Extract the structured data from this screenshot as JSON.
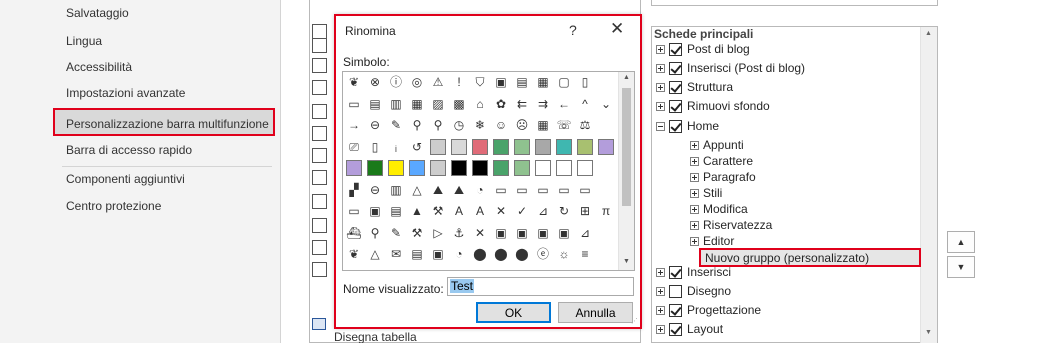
{
  "nav": {
    "items": [
      {
        "label": "Salvataggio",
        "name": "nav-item-salvataggio"
      },
      {
        "label": "Lingua",
        "name": "nav-item-lingua"
      },
      {
        "label": "Accessibilità",
        "name": "nav-item-accessibilita"
      },
      {
        "label": "Impostazioni avanzate",
        "name": "nav-item-impostazioni-avanzate"
      },
      {
        "label": "Personalizzazione barra multifunzione",
        "name": "nav-item-personalizzazione-barra",
        "selected": true
      },
      {
        "label": "Barra di accesso rapido",
        "name": "nav-item-barra-accesso-rapido"
      },
      {
        "label": "Componenti aggiuntivi",
        "name": "nav-item-componenti-aggiuntivi"
      },
      {
        "label": "Centro protezione",
        "name": "nav-item-centro-protezione"
      }
    ]
  },
  "commands": {
    "bottom_item": "Disegna tabella"
  },
  "tree": {
    "header": "Schede principali",
    "rows": [
      {
        "label": "Post di blog",
        "checked": true,
        "level": 0,
        "expander": "plus"
      },
      {
        "label": "Inserisci (Post di blog)",
        "checked": true,
        "level": 0,
        "expander": "plus"
      },
      {
        "label": "Struttura",
        "checked": true,
        "level": 0,
        "expander": "plus"
      },
      {
        "label": "Rimuovi sfondo",
        "checked": true,
        "level": 0,
        "expander": "plus"
      },
      {
        "label": "Home",
        "checked": true,
        "level": 0,
        "expander": "minus"
      },
      {
        "label": "Appunti",
        "level": 1,
        "expander": "plus"
      },
      {
        "label": "Carattere",
        "level": 1,
        "expander": "plus"
      },
      {
        "label": "Paragrafo",
        "level": 1,
        "expander": "plus"
      },
      {
        "label": "Stili",
        "level": 1,
        "expander": "plus"
      },
      {
        "label": "Modifica",
        "level": 1,
        "expander": "plus"
      },
      {
        "label": "Riservatezza",
        "level": 1,
        "expander": "plus"
      },
      {
        "label": "Editor",
        "level": 1,
        "expander": "plus"
      },
      {
        "label": "Nuovo gruppo (personalizzato)",
        "level": 2,
        "expander": "none",
        "highlighted": true
      },
      {
        "label": "Inserisci",
        "checked": true,
        "level": 0,
        "expander": "plus"
      },
      {
        "label": "Disegno",
        "checked": false,
        "level": 0,
        "expander": "plus"
      },
      {
        "label": "Progettazione",
        "checked": true,
        "level": 0,
        "expander": "plus"
      },
      {
        "label": "Layout",
        "checked": true,
        "level": 0,
        "expander": "plus"
      }
    ]
  },
  "move_buttons": {
    "up_icon": "triangle-up-icon",
    "down_icon": "triangle-down-icon"
  },
  "dialog": {
    "title": "Rinomina",
    "help": "?",
    "close": "✕",
    "symbol_label": "Simbolo:",
    "name_label": "Nome visualizzato:",
    "name_value": "Test",
    "ok_label": "OK",
    "cancel_label": "Annulla",
    "symbols": [
      [
        "❦",
        "⊗",
        "ⓘ",
        "◎",
        "⚠",
        "!",
        "⛉",
        "▣",
        "▤",
        "▦",
        "▢",
        "▯"
      ],
      [
        "▭",
        "▤",
        "▥",
        "▦",
        "▨",
        "▩",
        "⌂",
        "✿",
        "⇇",
        "⇉",
        "←",
        "^",
        "⌄"
      ],
      [
        "→",
        "⊖",
        "✎",
        "⚲",
        "⚲",
        "◷",
        "❄",
        "☺",
        "☹",
        "▦",
        "☏",
        "⚖"
      ],
      [
        "⎚",
        "▯",
        "ᵢ",
        "↺",
        "⇄",
        "⇆",
        "⊕",
        "⊗",
        "⬤",
        "⬤",
        "⬤",
        "⬤",
        "⬤"
      ],
      [
        "■",
        "■",
        "■",
        "■",
        "■",
        "■",
        "■",
        "■",
        "■",
        "□",
        "□",
        "▩"
      ],
      [
        "▞",
        "⊖",
        "▥",
        "△",
        "⛰",
        "⛰",
        "◔",
        "▭",
        "▭",
        "▭",
        "▭",
        "▭"
      ],
      [
        "▭",
        "▣",
        "▤",
        "▲",
        "⚒",
        "A",
        "A",
        "✕",
        "✓",
        "⊿",
        "↻",
        "⊞",
        "π"
      ],
      [
        "⛴",
        "⚲",
        "✎",
        "⚒",
        "▷",
        "⚓",
        "✕",
        "▣",
        "▣",
        "▣",
        "▣",
        "⊿"
      ],
      [
        "❦",
        "△",
        "✉",
        "▤",
        "▣",
        "◔",
        "⬤",
        "⬤",
        "⬤",
        "ⓔ",
        "☼",
        "≡"
      ]
    ],
    "swatch_colors": [
      "#cdcdcd",
      "#d9d9d9",
      "#e06b78",
      "#4aa36a",
      "#8fc28f",
      "#a8a8a8",
      "#3fb7b0",
      "#a8c070",
      "#b39ddb",
      "#1a7a1a",
      "#ffee00",
      "#5aa8ff"
    ]
  }
}
